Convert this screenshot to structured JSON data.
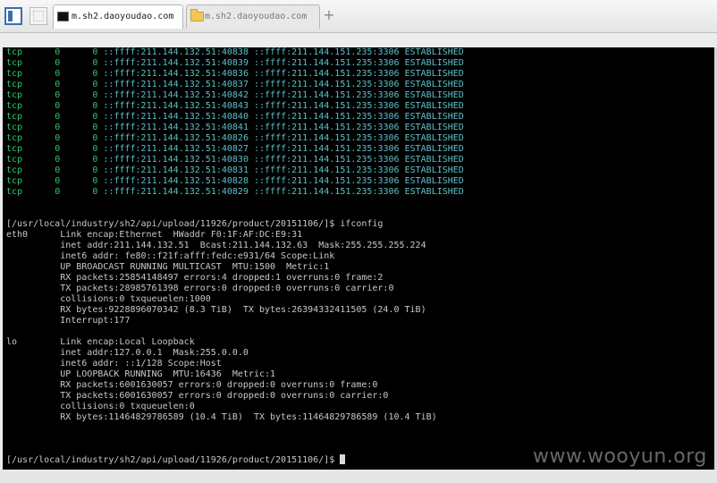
{
  "tabs": [
    {
      "label": "m.sh2.daoyoudao.com",
      "icon": "terminal-icon",
      "active": true
    },
    {
      "label": "m.sh2.daoyoudao.com",
      "icon": "folder-icon",
      "active": false
    }
  ],
  "new_tab_label": "+",
  "netstat_rows": [
    {
      "proto": "tcp",
      "recv": "0",
      "send": "0",
      "local": "::ffff:211.144.132.51:40838",
      "foreign": "::ffff:211.144.151.235:3306",
      "state": "ESTABLISHED"
    },
    {
      "proto": "tcp",
      "recv": "0",
      "send": "0",
      "local": "::ffff:211.144.132.51:40839",
      "foreign": "::ffff:211.144.151.235:3306",
      "state": "ESTABLISHED"
    },
    {
      "proto": "tcp",
      "recv": "0",
      "send": "0",
      "local": "::ffff:211.144.132.51:40836",
      "foreign": "::ffff:211.144.151.235:3306",
      "state": "ESTABLISHED"
    },
    {
      "proto": "tcp",
      "recv": "0",
      "send": "0",
      "local": "::ffff:211.144.132.51:40837",
      "foreign": "::ffff:211.144.151.235:3306",
      "state": "ESTABLISHED"
    },
    {
      "proto": "tcp",
      "recv": "0",
      "send": "0",
      "local": "::ffff:211.144.132.51:40842",
      "foreign": "::ffff:211.144.151.235:3306",
      "state": "ESTABLISHED"
    },
    {
      "proto": "tcp",
      "recv": "0",
      "send": "0",
      "local": "::ffff:211.144.132.51:40843",
      "foreign": "::ffff:211.144.151.235:3306",
      "state": "ESTABLISHED"
    },
    {
      "proto": "tcp",
      "recv": "0",
      "send": "0",
      "local": "::ffff:211.144.132.51:40840",
      "foreign": "::ffff:211.144.151.235:3306",
      "state": "ESTABLISHED"
    },
    {
      "proto": "tcp",
      "recv": "0",
      "send": "0",
      "local": "::ffff:211.144.132.51:40841",
      "foreign": "::ffff:211.144.151.235:3306",
      "state": "ESTABLISHED"
    },
    {
      "proto": "tcp",
      "recv": "0",
      "send": "0",
      "local": "::ffff:211.144.132.51:40826",
      "foreign": "::ffff:211.144.151.235:3306",
      "state": "ESTABLISHED"
    },
    {
      "proto": "tcp",
      "recv": "0",
      "send": "0",
      "local": "::ffff:211.144.132.51:40827",
      "foreign": "::ffff:211.144.151.235:3306",
      "state": "ESTABLISHED"
    },
    {
      "proto": "tcp",
      "recv": "0",
      "send": "0",
      "local": "::ffff:211.144.132.51:40830",
      "foreign": "::ffff:211.144.151.235:3306",
      "state": "ESTABLISHED"
    },
    {
      "proto": "tcp",
      "recv": "0",
      "send": "0",
      "local": "::ffff:211.144.132.51:40831",
      "foreign": "::ffff:211.144.151.235:3306",
      "state": "ESTABLISHED"
    },
    {
      "proto": "tcp",
      "recv": "0",
      "send": "0",
      "local": "::ffff:211.144.132.51:40828",
      "foreign": "::ffff:211.144.151.235:3306",
      "state": "ESTABLISHED"
    },
    {
      "proto": "tcp",
      "recv": "0",
      "send": "0",
      "local": "::ffff:211.144.132.51:40829",
      "foreign": "::ffff:211.144.151.235:3306",
      "state": "ESTABLISHED"
    }
  ],
  "command_prompt": "[/usr/local/industry/sh2/api/upload/11926/product/20151106/]$ ifconfig",
  "ifconfig_lines": [
    "eth0      Link encap:Ethernet  HWaddr F0:1F:AF:DC:E9:31",
    "          inet addr:211.144.132.51  Bcast:211.144.132.63  Mask:255.255.255.224",
    "          inet6 addr: fe80::f21f:afff:fedc:e931/64 Scope:Link",
    "          UP BROADCAST RUNNING MULTICAST  MTU:1500  Metric:1",
    "          RX packets:25854148497 errors:4 dropped:1 overruns:0 frame:2",
    "          TX packets:28985761398 errors:0 dropped:0 overruns:0 carrier:0",
    "          collisions:0 txqueuelen:1000",
    "          RX bytes:9228896070342 (8.3 TiB)  TX bytes:26394332411505 (24.0 TiB)",
    "          Interrupt:177",
    "",
    "lo        Link encap:Local Loopback",
    "          inet addr:127.0.0.1  Mask:255.0.0.0",
    "          inet6 addr: ::1/128 Scope:Host",
    "          UP LOOPBACK RUNNING  MTU:16436  Metric:1",
    "          RX packets:6001630057 errors:0 dropped:0 overruns:0 frame:0",
    "          TX packets:6001630057 errors:0 dropped:0 overruns:0 carrier:0",
    "          collisions:0 txqueuelen:0",
    "          RX bytes:11464829786589 (10.4 TiB)  TX bytes:11464829786589 (10.4 TiB)"
  ],
  "final_prompt": "[/usr/local/industry/sh2/api/upload/11926/product/20151106/]$ ",
  "watermark": "www.wooyun.org",
  "colors": {
    "terminal_bg": "#000000",
    "text": "#c8c8c8",
    "proto_green": "#2ec76b",
    "address_cyan": "#5bc1c9"
  }
}
